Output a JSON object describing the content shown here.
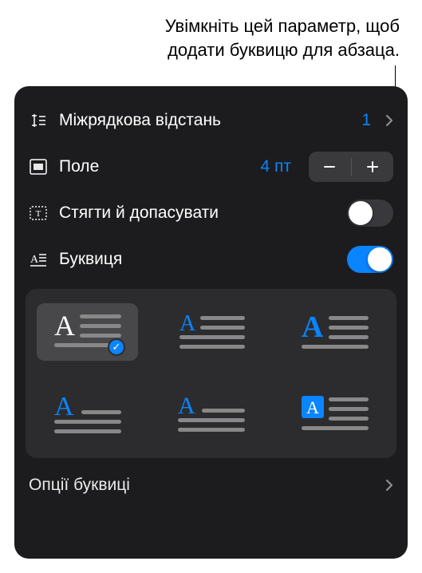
{
  "callout": {
    "line1": "Увімкніть цей параметр, щоб",
    "line2": "додати буквицю для абзаца."
  },
  "rows": {
    "lineSpacing": {
      "label": "Міжрядкова відстань",
      "value": "1"
    },
    "margin": {
      "label": "Поле",
      "value": "4 пт"
    },
    "shrinkFit": {
      "label": "Стягти й допасувати"
    },
    "dropCap": {
      "label": "Буквиця"
    }
  },
  "dropCapOptions": {
    "optionsLabel": "Опції буквиці"
  }
}
